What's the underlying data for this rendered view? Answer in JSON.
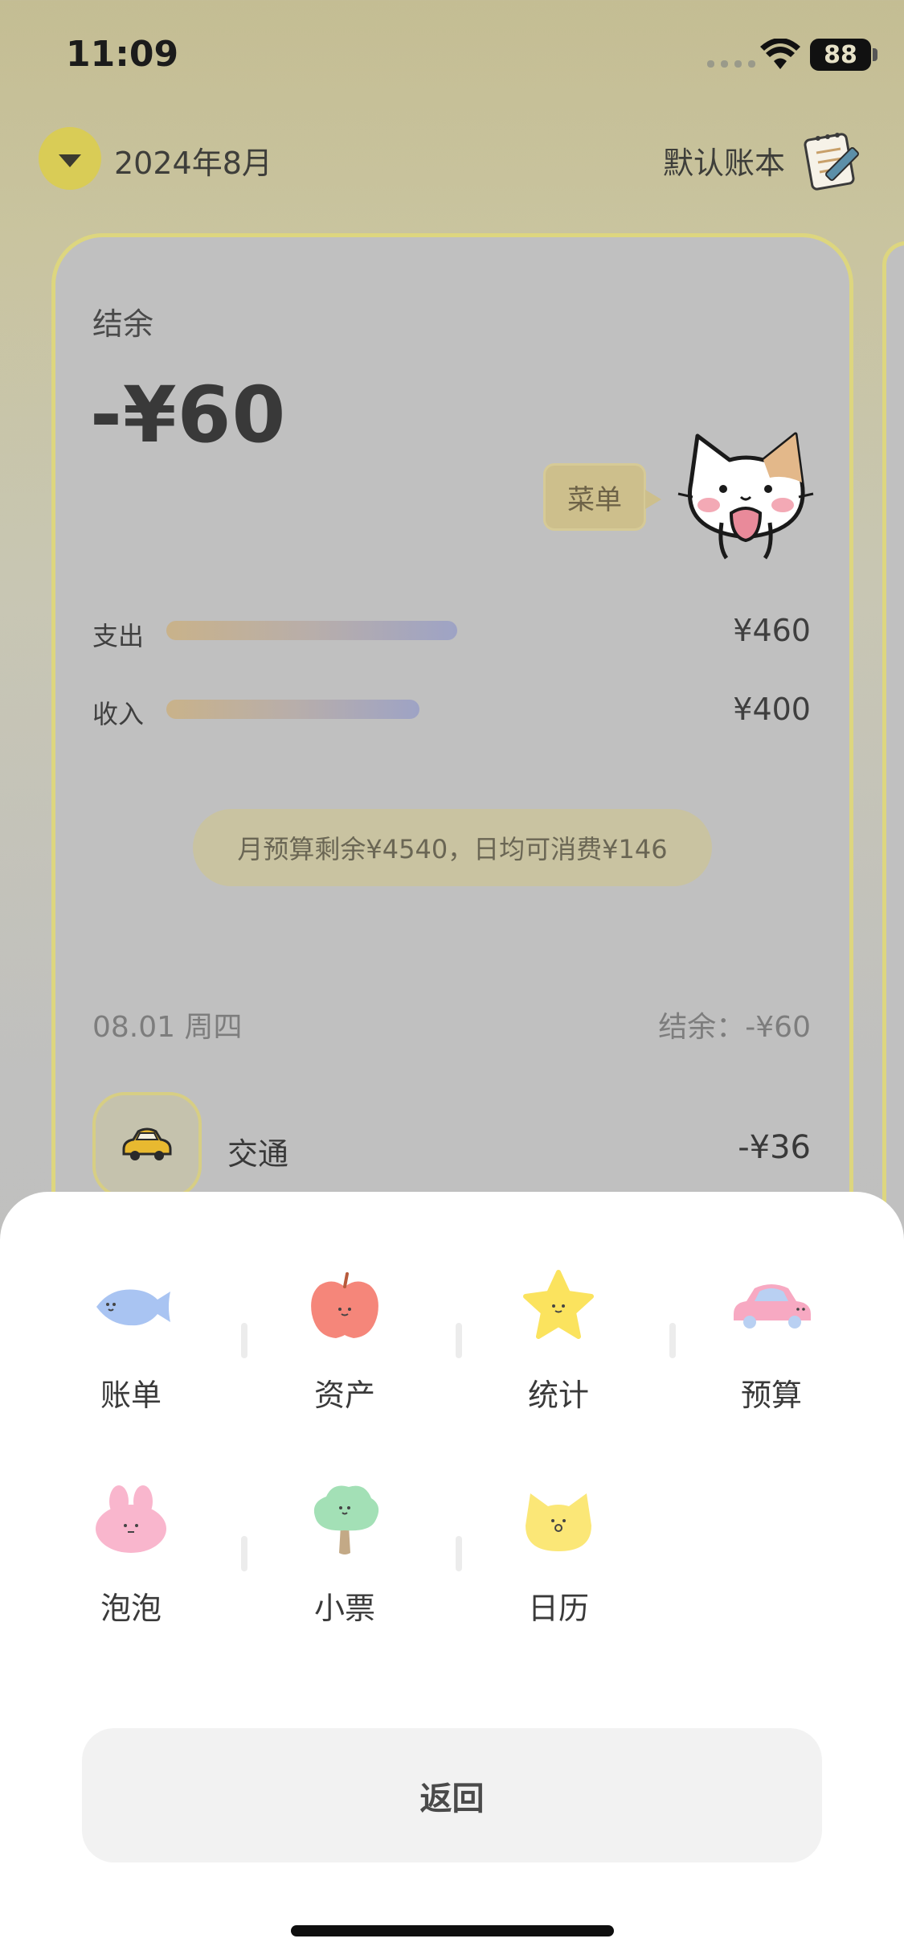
{
  "status": {
    "time": "11:09",
    "battery": "88"
  },
  "header": {
    "month": "2024年8月",
    "book": "默认账本"
  },
  "summary": {
    "balance_label": "结余",
    "balance_value": "-¥60",
    "menu_bubble": "菜单",
    "expense": {
      "label": "支出",
      "amount": "¥460",
      "fraction": 0.78
    },
    "income": {
      "label": "收入",
      "amount": "¥400",
      "fraction": 0.68
    },
    "budget_text": "月预算剩余¥4540，日均可消费¥146"
  },
  "day": {
    "date": "08.01 周四",
    "balance": "结余：-¥60"
  },
  "transaction": {
    "category": "交通",
    "amount": "-¥36",
    "icon": "taxi-icon"
  },
  "menu": {
    "items": [
      {
        "label": "账单",
        "icon": "fish-icon"
      },
      {
        "label": "资产",
        "icon": "apple-icon"
      },
      {
        "label": "统计",
        "icon": "star-icon"
      },
      {
        "label": "预算",
        "icon": "car-icon"
      },
      {
        "label": "泡泡",
        "icon": "bunny-icon"
      },
      {
        "label": "小票",
        "icon": "tree-icon"
      },
      {
        "label": "日历",
        "icon": "cat-icon"
      }
    ],
    "back_label": "返回"
  },
  "colors": {
    "accent": "#d9cc56",
    "sheet": "#ffffff",
    "bar_start": "#c9b28a",
    "bar_end": "#9ea3c5"
  }
}
